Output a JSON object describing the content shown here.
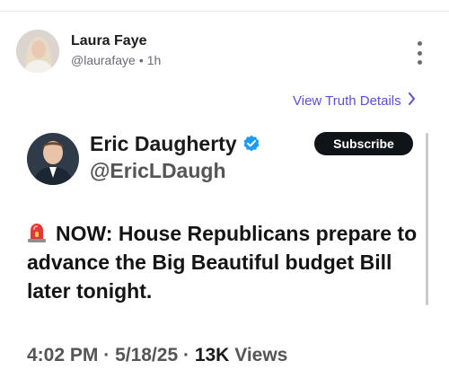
{
  "post": {
    "author_name": "Laura Faye",
    "author_handle": "@laurafaye",
    "dot": "•",
    "time_ago": "1h",
    "details_link": "View Truth Details",
    "details_chevron": "›"
  },
  "embed": {
    "name": "Eric Daugherty",
    "handle": "@EricLDaugh",
    "subscribe_label": "Subscribe",
    "text": "NOW: House Republicans prepare to advance the Big Beautiful budget Bill later tonight.",
    "time": "4:02 PM",
    "date": "5/18/25",
    "views_count": "13K",
    "views_label": "Views",
    "separator": "·"
  },
  "icons": {
    "menu": "kebab-menu-icon",
    "verified": "verified-badge-icon",
    "siren": "siren-emoji-icon",
    "chevron": "chevron-right-icon"
  },
  "colors": {
    "link": "#5b4fd9",
    "verified": "#1d9bf0",
    "subscribe_bg": "#0f1419"
  }
}
